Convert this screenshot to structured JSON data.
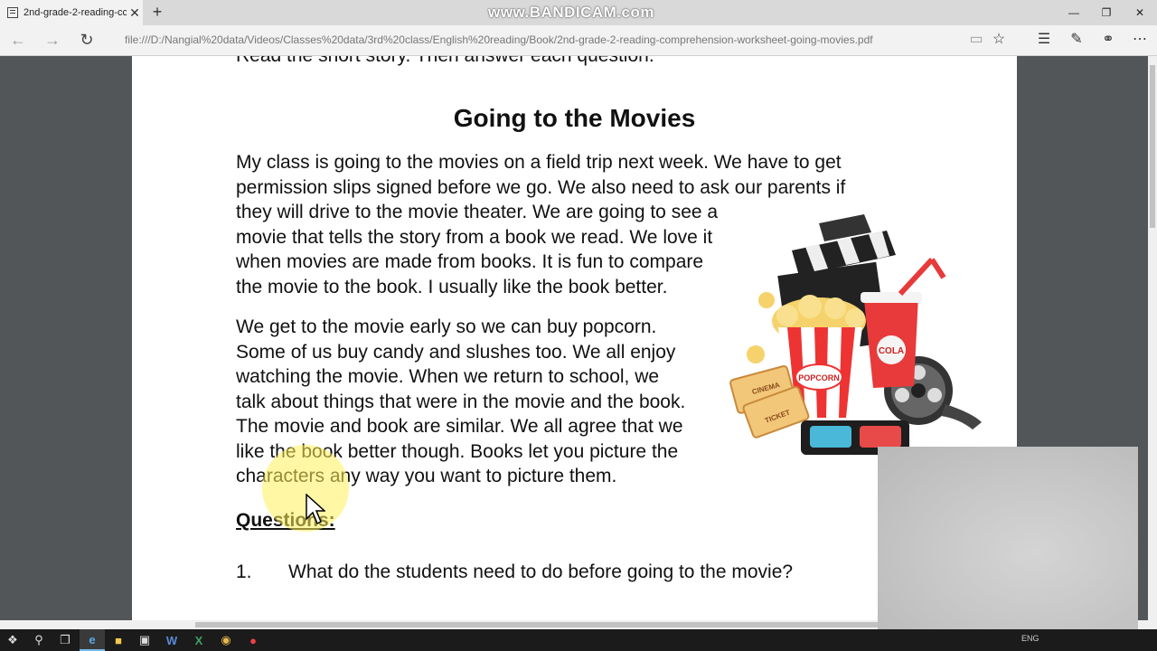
{
  "browser": {
    "tab_title": "2nd-grade-2-reading-cc",
    "tab_close": "✕",
    "new_tab": "+",
    "watermark": "www.BANDICAM.com",
    "url": "file:///D:/Nangial%20data/Videos/Classes%20data/3rd%20class/English%20reading/Book/2nd-grade-2-reading-comprehension-worksheet-going-movies.pdf",
    "icons": [
      "back-icon",
      "forward-icon",
      "refresh-icon",
      "reading-view-icon",
      "favorite-star-icon",
      "hub-icon",
      "web-note-icon",
      "share-icon",
      "more-icon"
    ]
  },
  "document": {
    "cut_line": "Read the short story. Then answer each question.",
    "title": "Going to the Movies",
    "paragraph1": [
      "My class is going to the movies on a field trip next week. We have to get",
      "permission slips signed before we go. We also need to ask our parents if",
      "they will drive to the movie theater. We are going to see a",
      "movie that tells the story from a book we read. We love it",
      "when movies are made from books. It is fun to compare",
      "the movie to the book. I usually like the book better."
    ],
    "paragraph2": [
      "We get to the movie early so we can buy popcorn.",
      "Some of us buy candy and slushes too. We all enjoy",
      "watching the movie. When we return to school, we",
      "talk about things that were in the movie and the book.",
      "The movie and book are similar. We all agree that we",
      "like the book better though. Books let you picture the",
      "characters any way you want to picture them."
    ],
    "questions_heading": "Questions:",
    "questions": [
      {
        "number": "1.",
        "text": "What do the students need to do before going to the movie?"
      }
    ],
    "clipart_labels": {
      "cinema": "CINEMA",
      "ticket": "TICKET",
      "popcorn": "POPCORN",
      "cola": "COLA"
    }
  },
  "taskbar": {
    "apps": [
      "windows-start-icon",
      "search-icon",
      "task-view-icon",
      "edge-icon",
      "file-explorer-icon",
      "store-icon",
      "word-icon",
      "excel-icon",
      "chrome-icon",
      "bandicam-icon"
    ],
    "tray_lang": "ENG"
  },
  "colors": {
    "accent": "#76b9ed",
    "page_bg": "#525659",
    "taskbar": "#1b1b1b"
  }
}
